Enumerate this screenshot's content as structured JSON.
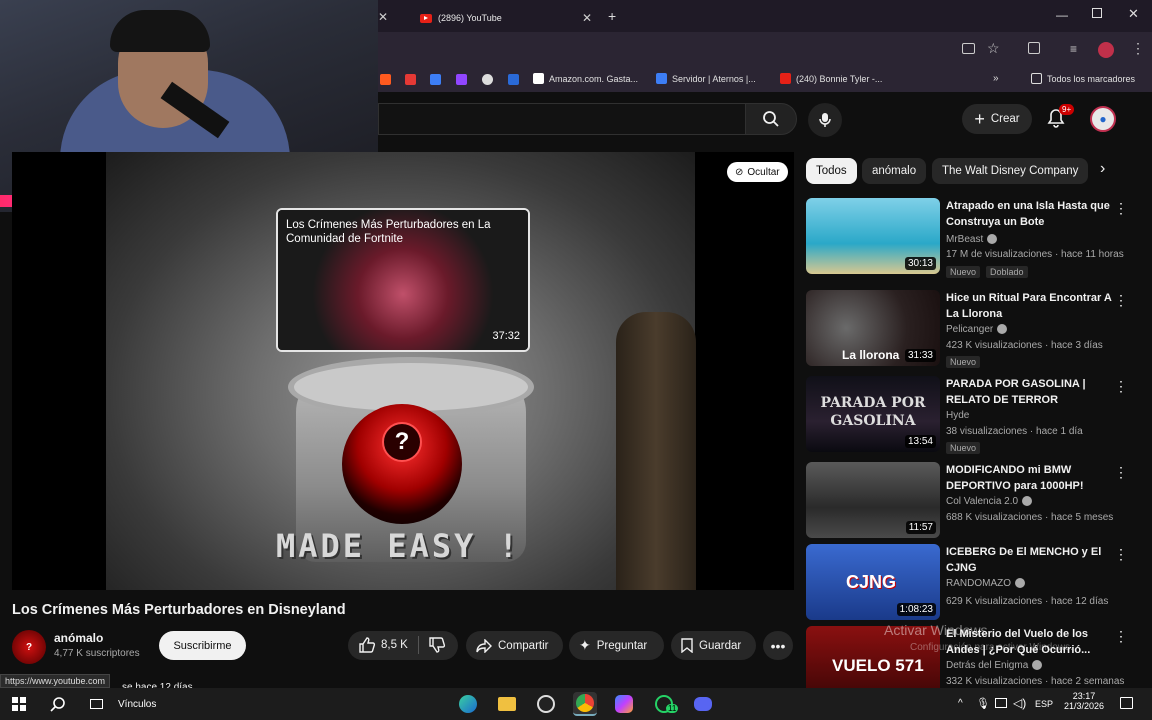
{
  "browser": {
    "tabs": [
      {
        "label": "(2896) YouTube"
      }
    ],
    "bookmarks": [
      {
        "label": "Amazon.com. Gasta..."
      },
      {
        "label": "Servidor | Aternos |..."
      },
      {
        "label": "(240) Bonnie Tyler -..."
      },
      {
        "label": "Todos los marcadores"
      }
    ]
  },
  "header": {
    "create_label": "Crear",
    "notif_count": "9+"
  },
  "player": {
    "hide_label": "Ocultar",
    "frame_text": "MADE EASY !",
    "endcard": {
      "title": "Los Crímenes Más Perturbadores en La Comunidad de Fortnite",
      "duration": "37:32"
    }
  },
  "video": {
    "title": "Los Crímenes Más Perturbadores en Disneyland",
    "channel": "anómalo",
    "subscribers": "4,77 K suscriptores",
    "subscribe_label": "Suscribirme",
    "likes": "8,5 K",
    "share_label": "Compartir",
    "ask_label": "Preguntar",
    "save_label": "Guardar",
    "desc_partial": "se hace 12 días"
  },
  "chips": [
    "Todos",
    "anómalo",
    "The Walt Disney Company"
  ],
  "recommendations": [
    {
      "title": "Atrapado en una Isla Hasta que Construya un Bote",
      "channel": "MrBeast",
      "meta": "17 M de visualizaciones · hace 11 horas",
      "badge": "Nuevo",
      "extra": "Doblado",
      "duration": "30:13",
      "color": "#2aa8c8"
    },
    {
      "title": "Hice un Ritual Para Encontrar A La Llorona",
      "channel": "Pelicanger",
      "meta": "423 K visualizaciones · hace 3 días",
      "badge": "Nuevo",
      "extra": "",
      "duration": "31:33",
      "color": "#3a2a2a"
    },
    {
      "title": "PARADA POR GASOLINA | RELATO DE TERROR",
      "channel": "Hyde",
      "meta": "38 visualizaciones · hace 1 día",
      "badge": "Nuevo",
      "extra": "",
      "duration": "13:54",
      "color": "#1a1a24"
    },
    {
      "title": "MODIFICANDO mi BMW DEPORTIVO para 1000HP!",
      "channel": "Col Valencia 2.0",
      "meta": "688 K visualizaciones · hace 5 meses",
      "badge": "",
      "extra": "",
      "duration": "11:57",
      "color": "#3a3a3a"
    },
    {
      "title": "ICEBERG De El MENCHO y El CJNG",
      "channel": "RANDOMAZO",
      "meta": "629 K visualizaciones · hace 12 días",
      "badge": "",
      "extra": "",
      "duration": "1:08:23",
      "color": "#2a4a8a"
    },
    {
      "title": "El Misterio del Vuelo de los Andes | ¿Por Qué Ocurrió...",
      "channel": "Detrás del Enigma",
      "meta": "332 K visualizaciones · hace 2 semanas",
      "badge": "",
      "extra": "",
      "duration": "",
      "color": "#6a1010"
    }
  ],
  "thumb_texts": [
    "La llorona",
    "PARADA POR GASOLINA",
    "CJNG",
    "VUELO 571"
  ],
  "overlay": {
    "status_url": "https://www.youtube.com",
    "activate_windows": "Activar Windows",
    "activate_windows_sub": "Configuración para activar Windows."
  },
  "taskbar": {
    "links_label": "Vínculos",
    "lang": "ESP",
    "time": "23:17",
    "date": "21/3/2026",
    "whatsapp_count": "11"
  }
}
